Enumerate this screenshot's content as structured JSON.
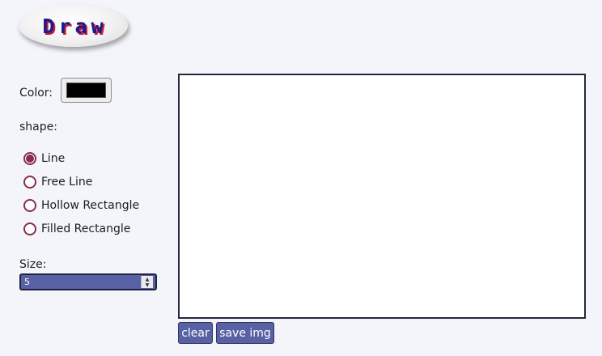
{
  "logo": {
    "text": "Draw"
  },
  "controls": {
    "color_label": "Color:",
    "color_value": "#000000",
    "shape_label": "shape:",
    "shapes": [
      {
        "label": "Line",
        "selected": true
      },
      {
        "label": "Free Line",
        "selected": false
      },
      {
        "label": "Hollow Rectangle",
        "selected": false
      },
      {
        "label": "Filled Rectangle",
        "selected": false
      }
    ],
    "size_label": "Size:",
    "size_value": "5"
  },
  "actions": {
    "clear_label": "clear",
    "save_label": "save img"
  },
  "colors": {
    "accent": "#5761a4",
    "radio": "#8a2c4e",
    "background": "#f4f5fb"
  }
}
